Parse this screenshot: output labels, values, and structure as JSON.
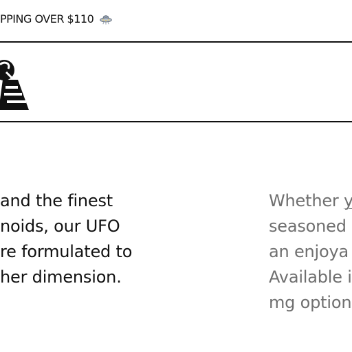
{
  "announcement": {
    "text": "PPING OVER $110",
    "icon": "ufo-icon"
  },
  "header": {
    "logo": "brand-logo"
  },
  "intro_left": {
    "lines": [
      "and the finest",
      "noids, our UFO",
      "re formulated to",
      "her dimension."
    ]
  },
  "intro_right": {
    "lines": [
      "Whether ",
      "y",
      "seasoned",
      "an enjoya",
      "Available i",
      "mg option"
    ]
  },
  "colors": {
    "text_primary": "#111111",
    "text_secondary": "#6f6f6f",
    "rule": "#111111",
    "background": "#ffffff"
  }
}
